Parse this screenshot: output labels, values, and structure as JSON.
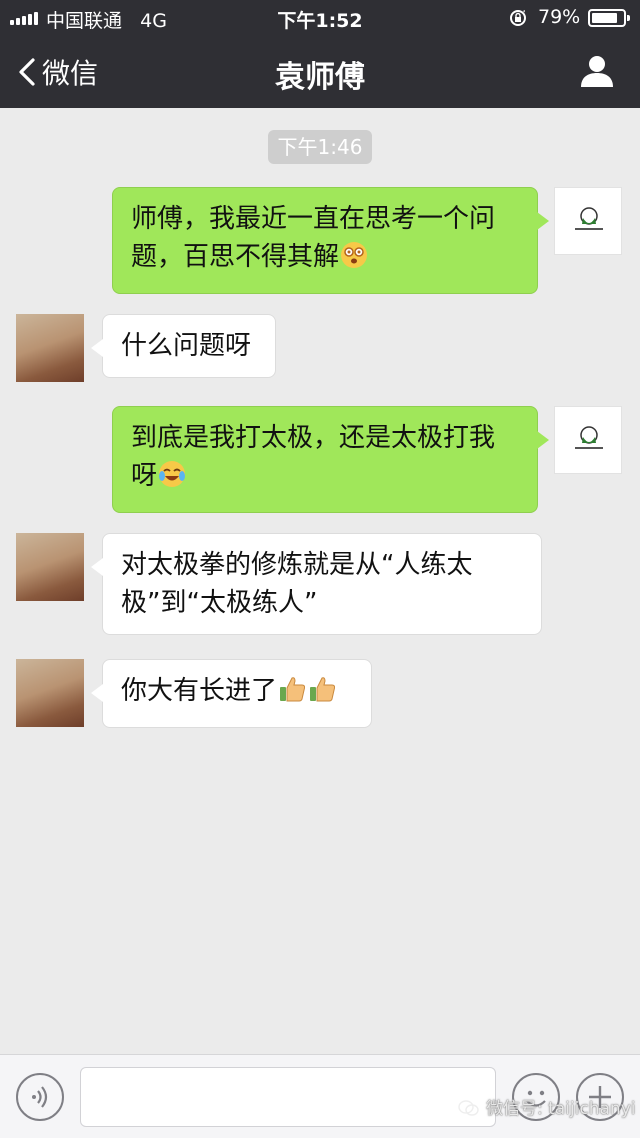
{
  "status_bar": {
    "carrier": "中国联通",
    "network": "4G",
    "time": "下午1:52",
    "battery_percent": "79%",
    "battery_level": 0.79
  },
  "nav": {
    "back_label": "微信",
    "title": "袁师傅"
  },
  "chat": {
    "timestamp": "下午1:46",
    "messages": [
      {
        "side": "right",
        "text": "师傅，我最近一直在思考一个问题，百思不得其解",
        "emoji": "dizzy-face-icon"
      },
      {
        "side": "left",
        "text": "什么问题呀"
      },
      {
        "side": "right",
        "text": "到底是我打太极，还是太极打我呀",
        "emoji": "tears-of-joy-icon"
      },
      {
        "side": "left",
        "text": "对太极拳的修炼就是从“人练太极”到“太极练人”"
      },
      {
        "side": "left",
        "text": "你大有长进了",
        "emoji": "thumbs-up-icon ×2"
      }
    ]
  },
  "watermark": {
    "text": "微信号: taijichanyi"
  },
  "colors": {
    "header_bg": "#2f2f34",
    "chat_bg": "#ebebeb",
    "sent_bubble": "#a0e75a",
    "received_bubble": "#ffffff"
  }
}
